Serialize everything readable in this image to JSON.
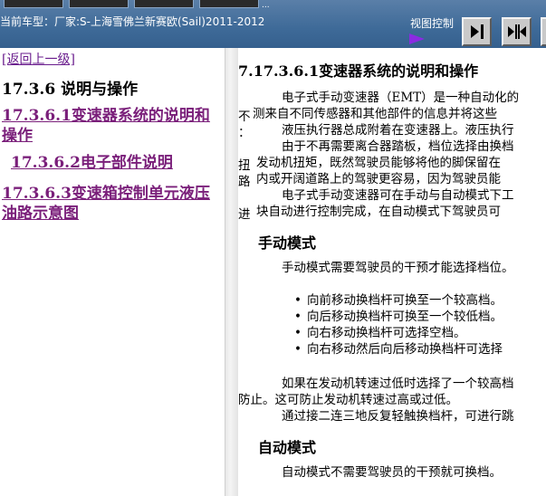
{
  "header": {
    "car_label": "当前车型：厂家:S-上海雪佛兰新赛欧(Sail)2011-2012",
    "view_control_label": "视图控制",
    "tab_dots": "..."
  },
  "left": {
    "back_link": "[返回上一级]",
    "section_title": "17.3.6 说明与操作",
    "toc": [
      {
        "label": "17.3.6.1变速器系统的说明和操作"
      },
      {
        "label": "17.3.6.2电子部件说明"
      },
      {
        "label": "17.3.6.3变速箱控制单元液压油路示意图"
      }
    ]
  },
  "right": {
    "title": "7.17.3.6.1变速器系统的说明和操作",
    "lines": [
      "电子式手动变速器（EMT）是一种自动化的",
      "测来自不同传感器和其他部件的信息并将这些",
      "液压执行器总成附着在变速器上。液压执行",
      "由于不再需要离合器踏板，档位选择由换档",
      "发动机扭矩，既然驾驶员能够将他的脚保留在",
      "内或开阔道路上的驾驶更容易，因为驾驶员能",
      "电子式手动变速器可在手动与自动模式下工",
      "块自动进行控制完成，在自动模式下驾驶员可"
    ],
    "cut_chars": [
      "不",
      "：",
      "扭",
      "路",
      "进"
    ],
    "manual_heading": "手动模式",
    "manual_intro": "手动模式需要驾驶员的干预才能选择档位。",
    "bullets": [
      "向前移动换档杆可换至一个较高档。",
      "向后移动换档杆可换至一个较低档。",
      "向右移动换档杆可选择空档。",
      "向右移动然后向后移动换档杆可选择"
    ],
    "para2_line1": "如果在发动机转速过低时选择了一个较高档",
    "para2_line2": "防止。这可防止发动机转速过高或过低。",
    "para2_line3": "通过接二连三地反复轻触换档杆，可进行跳",
    "auto_heading": "自动模式",
    "auto_intro": "自动模式不需要驾驶员的干预就可换档。"
  }
}
